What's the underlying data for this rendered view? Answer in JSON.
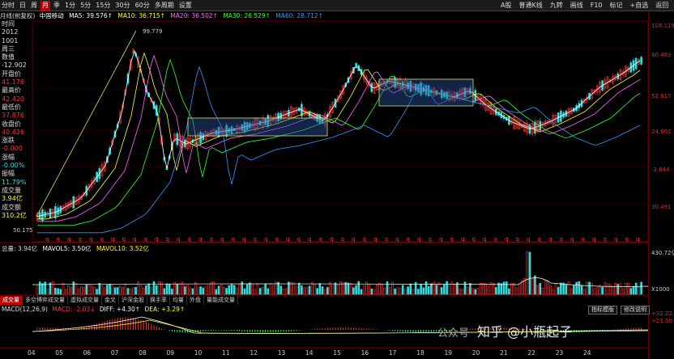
{
  "toolbar": {
    "items": [
      "分时",
      "日",
      "周",
      "月",
      "季",
      "1分",
      "5分",
      "15分",
      "30分",
      "60分",
      "多周期",
      "设置"
    ],
    "active": "月",
    "right_items": [
      "A股",
      "普通K线",
      "九转",
      "画线",
      "F10",
      "标记",
      "+自选",
      "返回"
    ]
  },
  "ma_bar": {
    "title": "月线(前复权)",
    "stock": "中国移动",
    "ma5": "MA5: 39.576↑",
    "ma10": "MA10: 36.715↑",
    "ma20": "MA20: 36.502↑",
    "ma30": "MA30: 26.529↑",
    "ma60": "MA60: 28.712↑"
  },
  "info": [
    {
      "k": "时间",
      "v": "2012"
    },
    {
      "k": "",
      "v": "1001"
    },
    {
      "k": "周三",
      "v": ""
    },
    {
      "k": "数值",
      "v": "-12.902"
    },
    {
      "k": "开盘价",
      "v": "41.176"
    },
    {
      "k": "最高价",
      "v": "42.420"
    },
    {
      "k": "最低价",
      "v": "37.876"
    },
    {
      "k": "收盘价",
      "v": "40.426"
    },
    {
      "k": "涨跌",
      "v": "-0.000"
    },
    {
      "k": "涨幅",
      "v": "-0.00%"
    },
    {
      "k": "振幅",
      "v": "11.79%"
    },
    {
      "k": "成交量",
      "v": "3.94亿"
    },
    {
      "k": "成交额",
      "v": "310.2亿"
    }
  ],
  "price_axis": [
    "108.119",
    "80.483",
    "52.617",
    "24.602",
    "-2.844",
    "30.491"
  ],
  "price_annotations": {
    "high": "99.779",
    "low": "50.175"
  },
  "volume": {
    "label": "总量: 3.94亿",
    "mavol5": "MAVOL5: 3.50亿",
    "mavol10": "MAVOL10: 3.52亿",
    "axis": [
      "430.72亿",
      "X1000"
    ]
  },
  "subtabs": [
    "成交量",
    "多空博弈成交量",
    "虚拟成交量",
    "金叉",
    "沪深金股",
    "换手率",
    "均量",
    "外盘",
    "量能成交量"
  ],
  "subtab_active": "成交量",
  "side_buttons": [
    "指标模版",
    "修改说明"
  ],
  "macd": {
    "label": "MACD(12,26,9)",
    "macd": "MACD: -2.03↓",
    "diff": "DIFF: +4.30↑",
    "dea": "DEA: +3.29↑",
    "axis": [
      "+32.22",
      "+21.50"
    ]
  },
  "x_axis": [
    "04",
    "05",
    "06",
    "07",
    "08",
    "09",
    "10",
    "11",
    "12",
    "13",
    "14",
    "15",
    "16",
    "17",
    "18",
    "19",
    "20",
    "21",
    "22",
    "23",
    "24"
  ],
  "watermark": {
    "source": "公众号",
    "text": "知乎 @小瓶起子"
  },
  "colors": {
    "up": "#ff3333",
    "down": "#33dddd",
    "ma5": "#ffffff",
    "ma10": "#ffff33",
    "ma20": "#ff66ff",
    "ma30": "#33ff33",
    "ma60": "#3399ff"
  }
}
